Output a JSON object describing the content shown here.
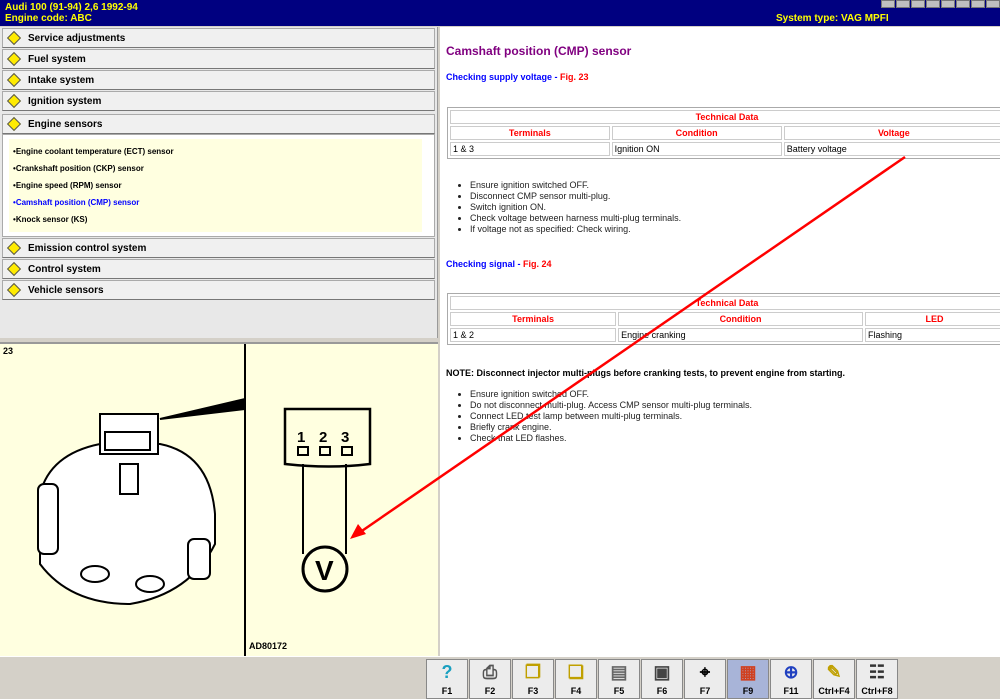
{
  "header": {
    "vehicle": "Audi   100 (91-94) 2,6  1992-94",
    "engine_code": "Engine code: ABC",
    "system_type": "System type: VAG MPFI"
  },
  "nav": {
    "items": [
      {
        "label": "Service adjustments"
      },
      {
        "label": "Fuel system"
      },
      {
        "label": "Intake system"
      },
      {
        "label": "Ignition system"
      },
      {
        "label": "Engine sensors",
        "expanded": true,
        "sub": [
          "Engine coolant temperature (ECT) sensor",
          "Crankshaft position (CKP) sensor",
          "Engine speed (RPM) sensor",
          "Camshaft position (CMP) sensor",
          "Knock sensor (KS)"
        ],
        "active_sub": 3
      },
      {
        "label": "Emission control system"
      },
      {
        "label": "Control system"
      },
      {
        "label": "Vehicle sensors"
      }
    ]
  },
  "figure": {
    "number": "23",
    "code": "AD80172",
    "pins": [
      "1",
      "2",
      "3"
    ],
    "meter": "V"
  },
  "content": {
    "title": "Camshaft position (CMP) sensor",
    "sec1": {
      "heading": "Checking supply voltage",
      "fig": "Fig. 23",
      "table": {
        "caption": "Technical Data",
        "headers": [
          "Terminals",
          "Condition",
          "Voltage"
        ],
        "row": [
          "1 & 3",
          "Ignition ON",
          "Battery voltage"
        ]
      },
      "steps": [
        "Ensure ignition switched OFF.",
        "Disconnect CMP sensor multi-plug.",
        "Switch ignition ON.",
        "Check voltage between harness multi-plug terminals.",
        "If voltage not as specified: Check wiring."
      ]
    },
    "sec2": {
      "heading": "Checking signal",
      "fig": "Fig. 24",
      "table": {
        "caption": "Technical Data",
        "headers": [
          "Terminals",
          "Condition",
          "LED"
        ],
        "row": [
          "1 & 2",
          "Engine cranking",
          "Flashing"
        ]
      }
    },
    "note": "NOTE: Disconnect injector multi-plugs before cranking tests, to prevent engine from starting.",
    "steps2": [
      "Ensure ignition switched OFF.",
      "Do not disconnect multi-plug. Access CMP sensor multi-plug terminals.",
      "Connect LED test lamp between multi-plug terminals.",
      "Briefly crank engine.",
      "Check that LED flashes."
    ]
  },
  "toolbar": {
    "keys": [
      {
        "label": "F1",
        "icon": "help-icon"
      },
      {
        "label": "F2",
        "icon": "print-icon"
      },
      {
        "label": "F3",
        "icon": "copy-icon"
      },
      {
        "label": "F4",
        "icon": "paste-icon"
      },
      {
        "label": "F5",
        "icon": "document-icon"
      },
      {
        "label": "F6",
        "icon": "component-icon"
      },
      {
        "label": "F7",
        "icon": "zoom-icon"
      },
      {
        "label": "F9",
        "icon": "fuse-icon",
        "active": true
      },
      {
        "label": "F11",
        "icon": "search-wiring-icon"
      },
      {
        "label": "Ctrl+F4",
        "icon": "notes-icon"
      },
      {
        "label": "Ctrl+F8",
        "icon": "table-icon"
      }
    ]
  },
  "colors": {
    "header": "#000080",
    "header_text": "#ffff00",
    "title": "#800080",
    "link": "#0000ff",
    "table_head": "#ff0000",
    "annotation": "#ff0000"
  }
}
